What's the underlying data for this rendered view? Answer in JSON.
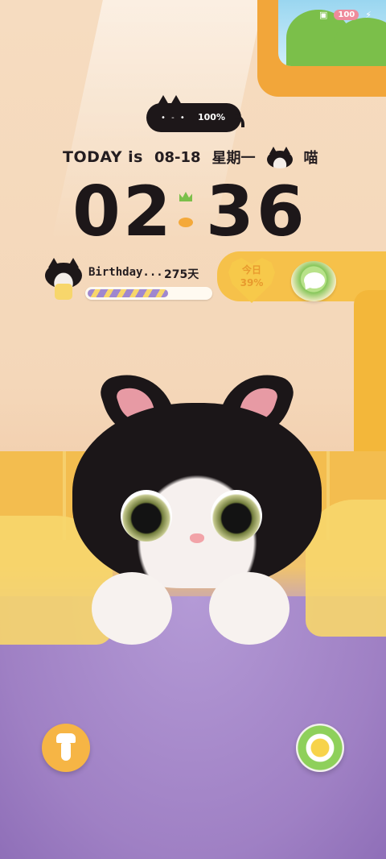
{
  "status_bar": {
    "battery_badge": "100",
    "icons": [
      "sim-icon",
      "charging-icon"
    ]
  },
  "battery_widget": {
    "face": "• - •",
    "percent": "100%"
  },
  "date_row": {
    "today_label": "TODAY is",
    "date": "08-18",
    "weekday": "星期一",
    "meow": "喵"
  },
  "clock": {
    "hours": "02",
    "minutes": "36"
  },
  "birthday": {
    "label": "Birthday...",
    "days": "275天",
    "progress_percent": 65
  },
  "today_heart": {
    "line1": "今日",
    "line2": "39%"
  },
  "colors": {
    "accent_yellow": "#f7c94a",
    "accent_green": "#86c65a",
    "accent_purple": "#9f87cf",
    "text_dark": "#241d20"
  }
}
